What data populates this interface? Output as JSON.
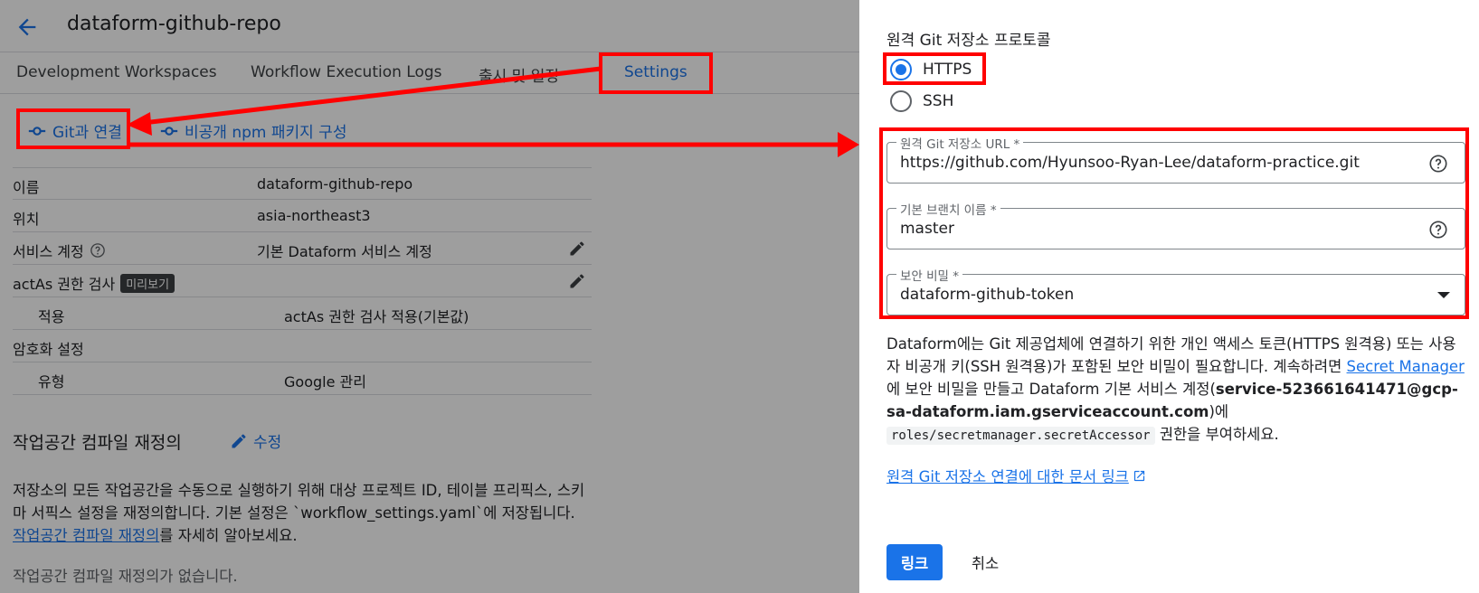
{
  "header": {
    "title": "dataform-github-repo"
  },
  "tabs": [
    {
      "label": "Development Workspaces"
    },
    {
      "label": "Workflow Execution Logs"
    },
    {
      "label": "출시 및 일정"
    },
    {
      "label": "Settings"
    }
  ],
  "actions": {
    "connect_git": "Git과 연결",
    "npm_config": "비공개 npm 패키지 구성"
  },
  "details": {
    "name_key": "이름",
    "name_val": "dataform-github-repo",
    "location_key": "위치",
    "location_val": "asia-northeast3",
    "service_account_key": "서비스 계정",
    "service_account_val": "기본 Dataform 서비스 계정",
    "actas_key": "actAs 권한 검사",
    "actas_badge": "미리보기",
    "apply_key": "적용",
    "apply_val": "actAs 권한 검사 적용(기본값)",
    "encryption_key": "암호화 설정",
    "type_key": "유형",
    "type_val": "Google 관리"
  },
  "override": {
    "title": "작업공간 컴파일 재정의",
    "edit_label": "수정",
    "para_text": "저장소의 모든 작업공간을 수동으로 실행하기 위해 대상 프로젝트 ID, 테이블 프리픽스, 스키마 서픽스 설정을 재정의합니다. 기본 설정은 `workflow_settings.yaml`에 저장됩니다.",
    "para_link": "작업공간 컴파일 재정의",
    "para_suffix": "를 자세히 알아보세요.",
    "empty_text": "작업공간 컴파일 재정의가 없습니다."
  },
  "panel": {
    "protocol_label": "원격 Git 저장소 프로토콜",
    "protocol_options": [
      {
        "label": "HTTPS",
        "selected": true
      },
      {
        "label": "SSH",
        "selected": false
      }
    ],
    "url_label": "원격 Git 저장소 URL *",
    "url_value": "https://github.com/Hyunsoo-Ryan-Lee/dataform-practice.git",
    "branch_label": "기본 브랜치 이름 *",
    "branch_value": "master",
    "secret_label": "보안 비밀 *",
    "secret_value": "dataform-github-token",
    "desc_1": "Dataform에는 Git 제공업체에 연결하기 위한 개인 액세스 토큰(HTTPS 원격용) 또는 사용자 비공개 키(SSH 원격용)가 포함된 보안 비밀이 필요합니다. 계속하려면 ",
    "desc_link": "Secret Manager",
    "desc_2": "에 보안 비밀을 만들고 Dataform 기본 서비스 계정(",
    "desc_account": "service-523661641471@gcp-sa-dataform.iam.gserviceaccount.com",
    "desc_3": ")에 ",
    "desc_role": "roles/secretmanager.secretAccessor",
    "desc_4": " 권한을 부여하세요.",
    "doc_link": "원격 Git 저장소 연결에 대한 문서 링크",
    "link_button": "링크",
    "cancel_button": "취소"
  },
  "colors": {
    "accent": "#1a73e8",
    "annotation": "#ff0000",
    "overlay": "rgba(0,0,0,0.38)"
  }
}
